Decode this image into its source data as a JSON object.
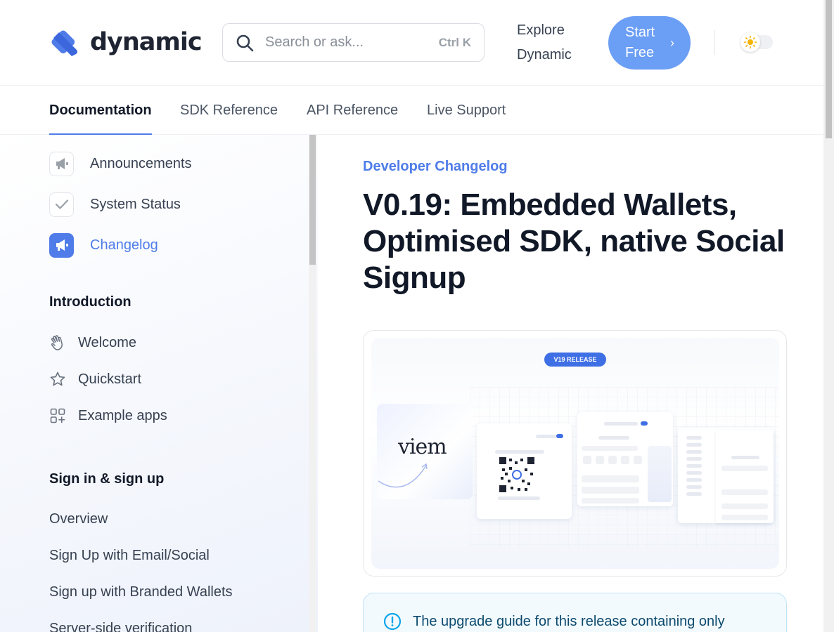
{
  "header": {
    "logo_text": "dynamic",
    "search_placeholder": "Search or ask...",
    "search_shortcut": "Ctrl K",
    "explore_label": "Explore Dynamic",
    "start_label": "Start Free",
    "start_chevron": "›"
  },
  "tabs": [
    {
      "label": "Documentation",
      "active": true
    },
    {
      "label": "SDK Reference"
    },
    {
      "label": "API Reference"
    },
    {
      "label": "Live Support"
    }
  ],
  "sidebar": {
    "anchors": [
      {
        "label": "Announcements",
        "icon": "megaphone-icon"
      },
      {
        "label": "System Status",
        "icon": "check-icon"
      },
      {
        "label": "Changelog",
        "icon": "megaphone-icon",
        "active": true
      }
    ],
    "groups": [
      {
        "title": "Introduction",
        "items": [
          {
            "label": "Welcome",
            "icon": "waving-hand-icon"
          },
          {
            "label": "Quickstart",
            "icon": "star-icon"
          },
          {
            "label": "Example apps",
            "icon": "grid-plus-icon"
          }
        ]
      },
      {
        "title": "Sign in & sign up",
        "items": [
          {
            "label": "Overview"
          },
          {
            "label": "Sign Up with Email/Social"
          },
          {
            "label": "Sign up with Branded Wallets"
          },
          {
            "label": "Server-side verification"
          }
        ]
      }
    ]
  },
  "content": {
    "eyebrow": "Developer Changelog",
    "title": "V0.19: Embedded Wallets, Optimised SDK, native Social Signup",
    "hero": {
      "badge": "V19 RELEASE",
      "viem_label": "viem"
    },
    "callout_text": "The upgrade guide for this release containing only"
  },
  "colors": {
    "accent": "#4f7ce8",
    "start_button": "#6b9ef5",
    "callout_border": "#bfe3f5",
    "callout_text": "#0c4a6e"
  }
}
